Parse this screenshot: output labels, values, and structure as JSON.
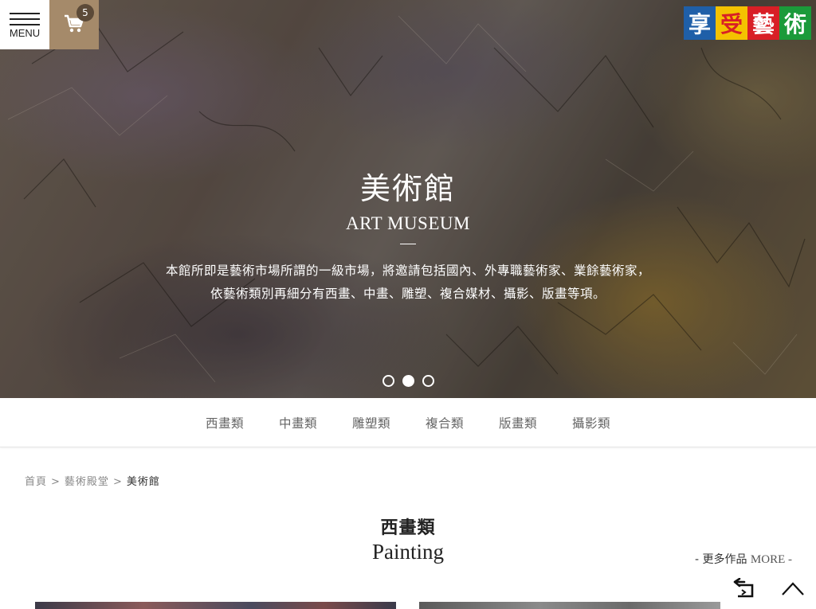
{
  "header": {
    "menu_label": "MENU",
    "cart_count": "5",
    "logo_chars": [
      "享",
      "受",
      "藝",
      "術"
    ]
  },
  "hero": {
    "title": "美術館",
    "subtitle": "ART MUSEUM",
    "description_line1": "本館所即是藝術市場所謂的一級市場，將邀請包括國內、外專職藝術家、業餘藝術家，",
    "description_line2": "依藝術類別再細分有西畫、中畫、雕塑、複合媒材、攝影、版畫等項。",
    "slides_total": 3,
    "slides_active": 2
  },
  "category_nav": {
    "items": [
      {
        "label": "西畫類"
      },
      {
        "label": "中畫類"
      },
      {
        "label": "雕塑類"
      },
      {
        "label": "複合類"
      },
      {
        "label": "版畫類"
      },
      {
        "label": "攝影類"
      }
    ]
  },
  "breadcrumb": {
    "items": [
      {
        "label": "首頁"
      },
      {
        "label": "藝術殿堂"
      },
      {
        "label": "美術館"
      }
    ],
    "separator": ">"
  },
  "section": {
    "title": "西畫類",
    "subtitle": "Painting",
    "more_prefix": "- 更多作品",
    "more_en": "MORE -"
  },
  "colors": {
    "cart_bg": "#a58a6a",
    "cart_badge": "#5c4a38",
    "logo_blue": "#1f5fa8",
    "logo_yellow": "#f4c200",
    "logo_red": "#d81f26",
    "logo_green": "#1b9a3a"
  },
  "icons": {
    "menu": "hamburger-icon",
    "cart": "cart-icon",
    "back": "return-icon",
    "top": "chevron-up-icon"
  }
}
